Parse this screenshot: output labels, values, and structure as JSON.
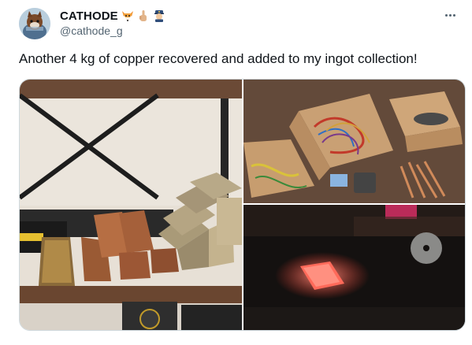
{
  "tweet": {
    "display_name": "CATHODE",
    "handle": "@cathode_g",
    "text": "Another 4 kg of copper recovered and added to my ingot collection!",
    "name_emojis": [
      "fox-face-icon",
      "middle-finger-icon",
      "police-officer-icon"
    ],
    "more_menu_icon": "more-options-icon"
  },
  "media": {
    "photos": [
      {
        "subject": "copper-ingots-on-shelf"
      },
      {
        "subject": "copper-wire-scrap-in-boxes"
      },
      {
        "subject": "glowing-ingot-in-dark"
      }
    ]
  },
  "colors": {
    "text": "#0f1419",
    "secondary": "#536471",
    "border": "#cfd9de",
    "copper": "#b5673f",
    "glow": "#ff6a5a"
  }
}
